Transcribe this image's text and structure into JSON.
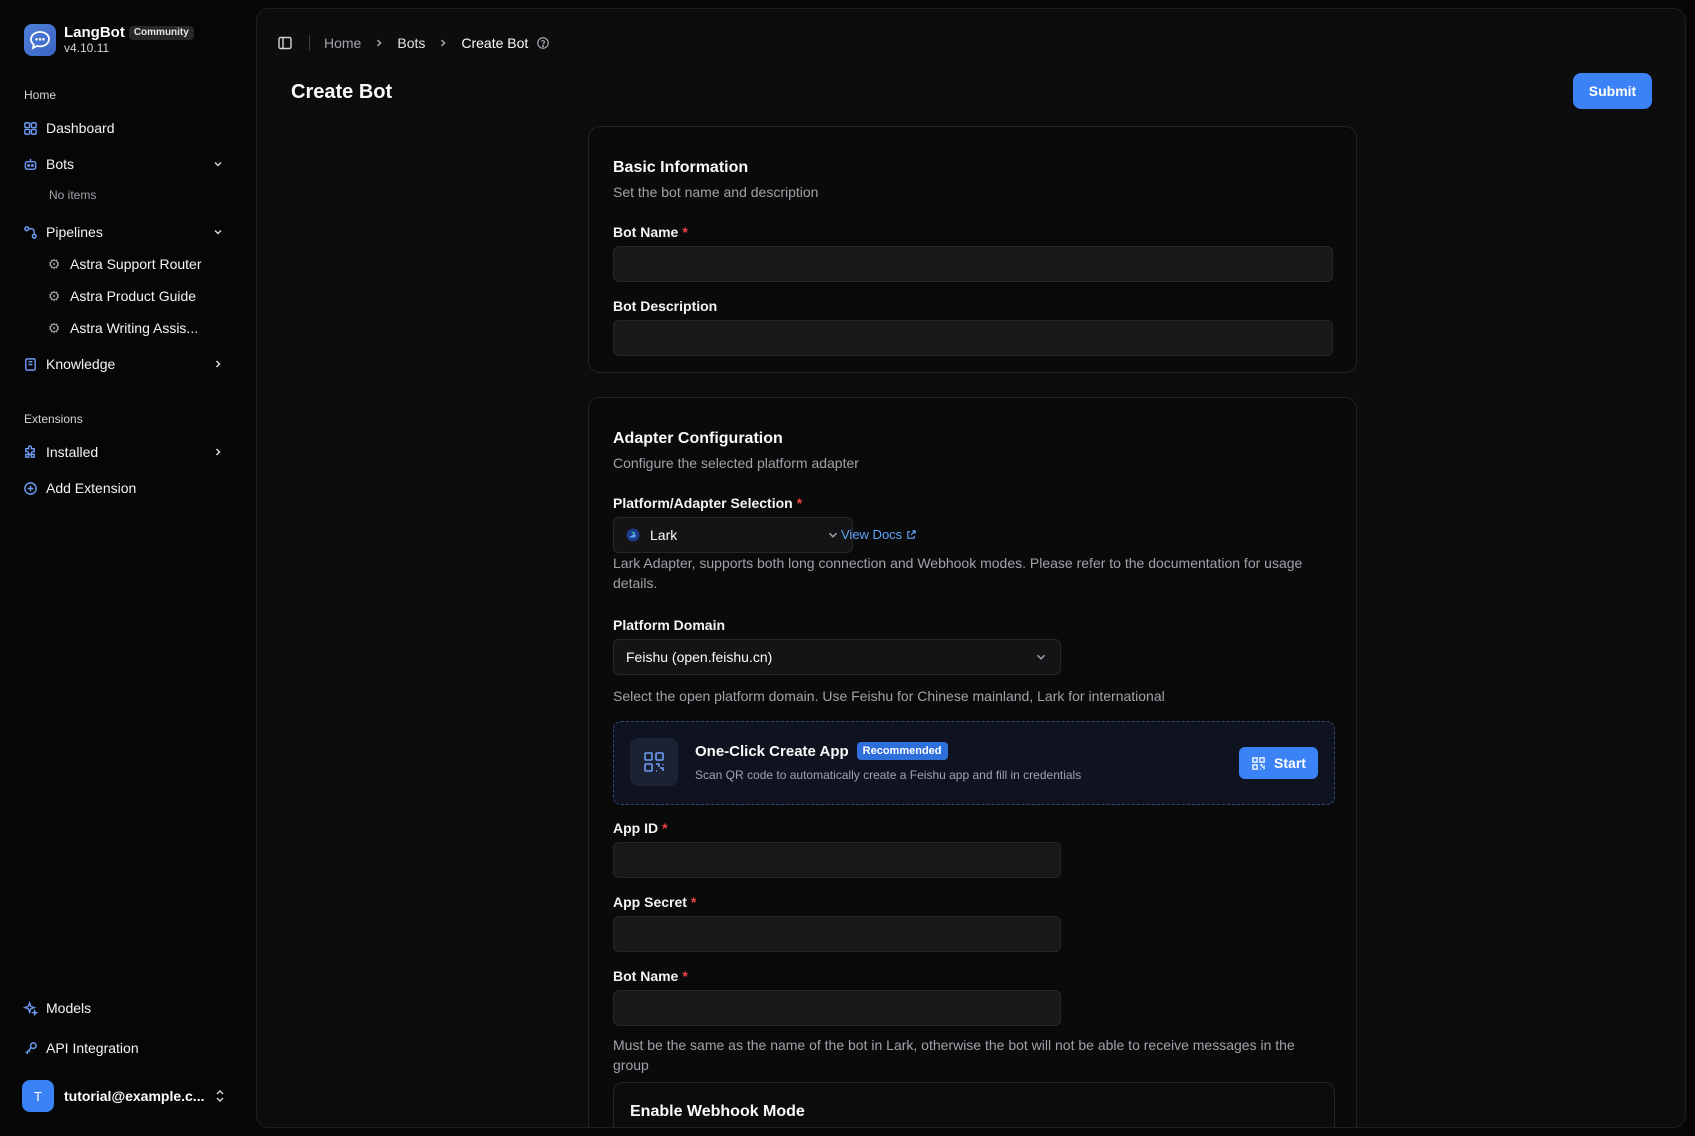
{
  "brand": {
    "name": "LangBot",
    "badge": "Community",
    "version": "v4.10.11"
  },
  "sidebar": {
    "group_home": "Home",
    "dashboard": "Dashboard",
    "bots": "Bots",
    "bots_empty": "No items",
    "pipelines": "Pipelines",
    "pipeline_items": [
      "Astra Support Router",
      "Astra Product Guide",
      "Astra Writing Assis..."
    ],
    "knowledge": "Knowledge",
    "group_extensions": "Extensions",
    "installed": "Installed",
    "add_extension": "Add Extension",
    "models": "Models",
    "api_integration": "API Integration"
  },
  "user": {
    "initial": "T",
    "email": "tutorial@example.c..."
  },
  "breadcrumb": {
    "home": "Home",
    "bots": "Bots",
    "current": "Create Bot"
  },
  "page": {
    "title": "Create Bot",
    "submit": "Submit"
  },
  "basic": {
    "title": "Basic Information",
    "desc": "Set the bot name and description",
    "name_label": "Bot Name",
    "name_value": "",
    "desc_label": "Bot Description",
    "desc_value": "",
    "required_mark": "*"
  },
  "adapter": {
    "title": "Adapter Configuration",
    "desc": "Configure the selected platform adapter",
    "platform_label": "Platform/Adapter Selection",
    "platform_value": "Lark",
    "view_docs": "View Docs",
    "platform_help": "Lark Adapter, supports both long connection and Webhook modes. Please refer to the documentation for usage details.",
    "domain_label": "Platform Domain",
    "domain_value": "Feishu (open.feishu.cn)",
    "domain_help": "Select the open platform domain. Use Feishu for Chinese mainland, Lark for international",
    "oneclick_title": "One-Click Create App",
    "oneclick_badge": "Recommended",
    "oneclick_desc": "Scan QR code to automatically create a Feishu app and fill in credentials",
    "start": "Start",
    "app_id_label": "App ID",
    "app_id_value": "",
    "app_secret_label": "App Secret",
    "app_secret_value": "",
    "bot_name_label": "Bot Name",
    "bot_name_value": "",
    "bot_name_help": "Must be the same as the name of the bot in Lark, otherwise the bot will not be able to receive messages in the group",
    "webhook_title": "Enable Webhook Mode"
  },
  "colors": {
    "accent": "#3b82f6",
    "required": "#ef4444",
    "link": "#60a5fa"
  }
}
